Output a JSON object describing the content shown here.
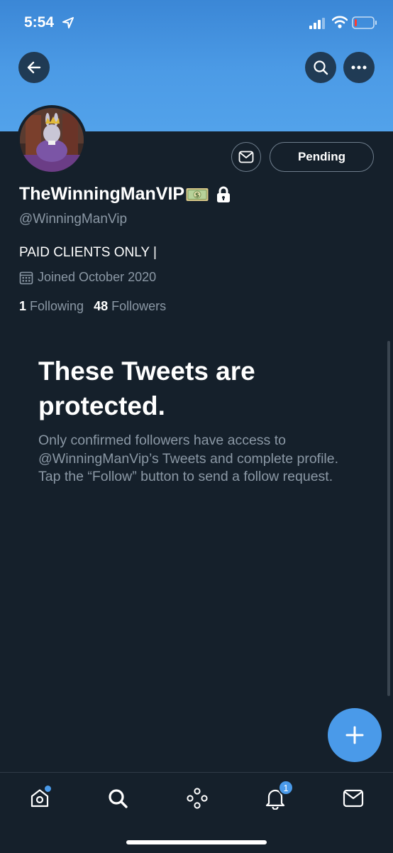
{
  "status_bar": {
    "time": "5:54"
  },
  "header": {
    "icons": [
      "back-arrow-icon",
      "search-icon",
      "more-icon"
    ]
  },
  "profile": {
    "display_name": "TheWinningManVIP",
    "handle": "@WinningManVip",
    "bio": "PAID CLIENTS ONLY |",
    "joined": "Joined October 2020",
    "following_count": "1",
    "following_label": "Following",
    "followers_count": "48",
    "followers_label": "Followers",
    "pending_label": "Pending"
  },
  "protected": {
    "title": "These Tweets are protected.",
    "description": "Only confirmed followers have access to @WinningManVip’s Tweets and complete profile. Tap the “Follow” button to send a follow request."
  },
  "tab_bar": {
    "tabs": [
      "home-icon",
      "search-icon",
      "spaces-icon",
      "notifications-icon",
      "messages-icon"
    ],
    "notification_badge": "1"
  },
  "colors": {
    "background": "#15202b",
    "accent": "#4a9ae9",
    "secondary_text": "#8b98a5"
  }
}
